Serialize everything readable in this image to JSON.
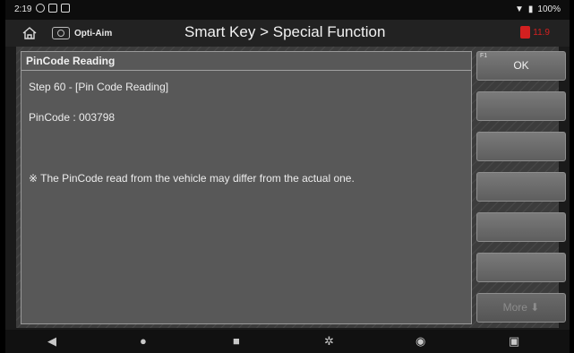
{
  "status_bar": {
    "time": "2:19",
    "battery": "100%"
  },
  "title_bar": {
    "brand": "Opti-Aim",
    "title": "Smart Key > Special Function",
    "battery_voltage": "11.9"
  },
  "panel": {
    "header": "PinCode Reading",
    "lines": [
      "Step 60 - [Pin Code Reading]",
      "PinCode : 003798",
      "",
      "※ The PinCode read from the vehicle may differ from the actual one."
    ]
  },
  "side_buttons": [
    {
      "key": "F1",
      "label": "OK"
    },
    {
      "key": "",
      "label": ""
    },
    {
      "key": "",
      "label": ""
    },
    {
      "key": "",
      "label": ""
    },
    {
      "key": "",
      "label": ""
    },
    {
      "key": "",
      "label": ""
    },
    {
      "key": "",
      "label": "More ⬇"
    }
  ],
  "nav_bar": {
    "icons": [
      "back-icon",
      "home-dot-icon",
      "recent-apps-icon",
      "settings-icon",
      "chrome-icon",
      "screenshot-icon"
    ]
  },
  "colors": {
    "accent_red": "#d32020",
    "panel_bg": "#585858"
  }
}
